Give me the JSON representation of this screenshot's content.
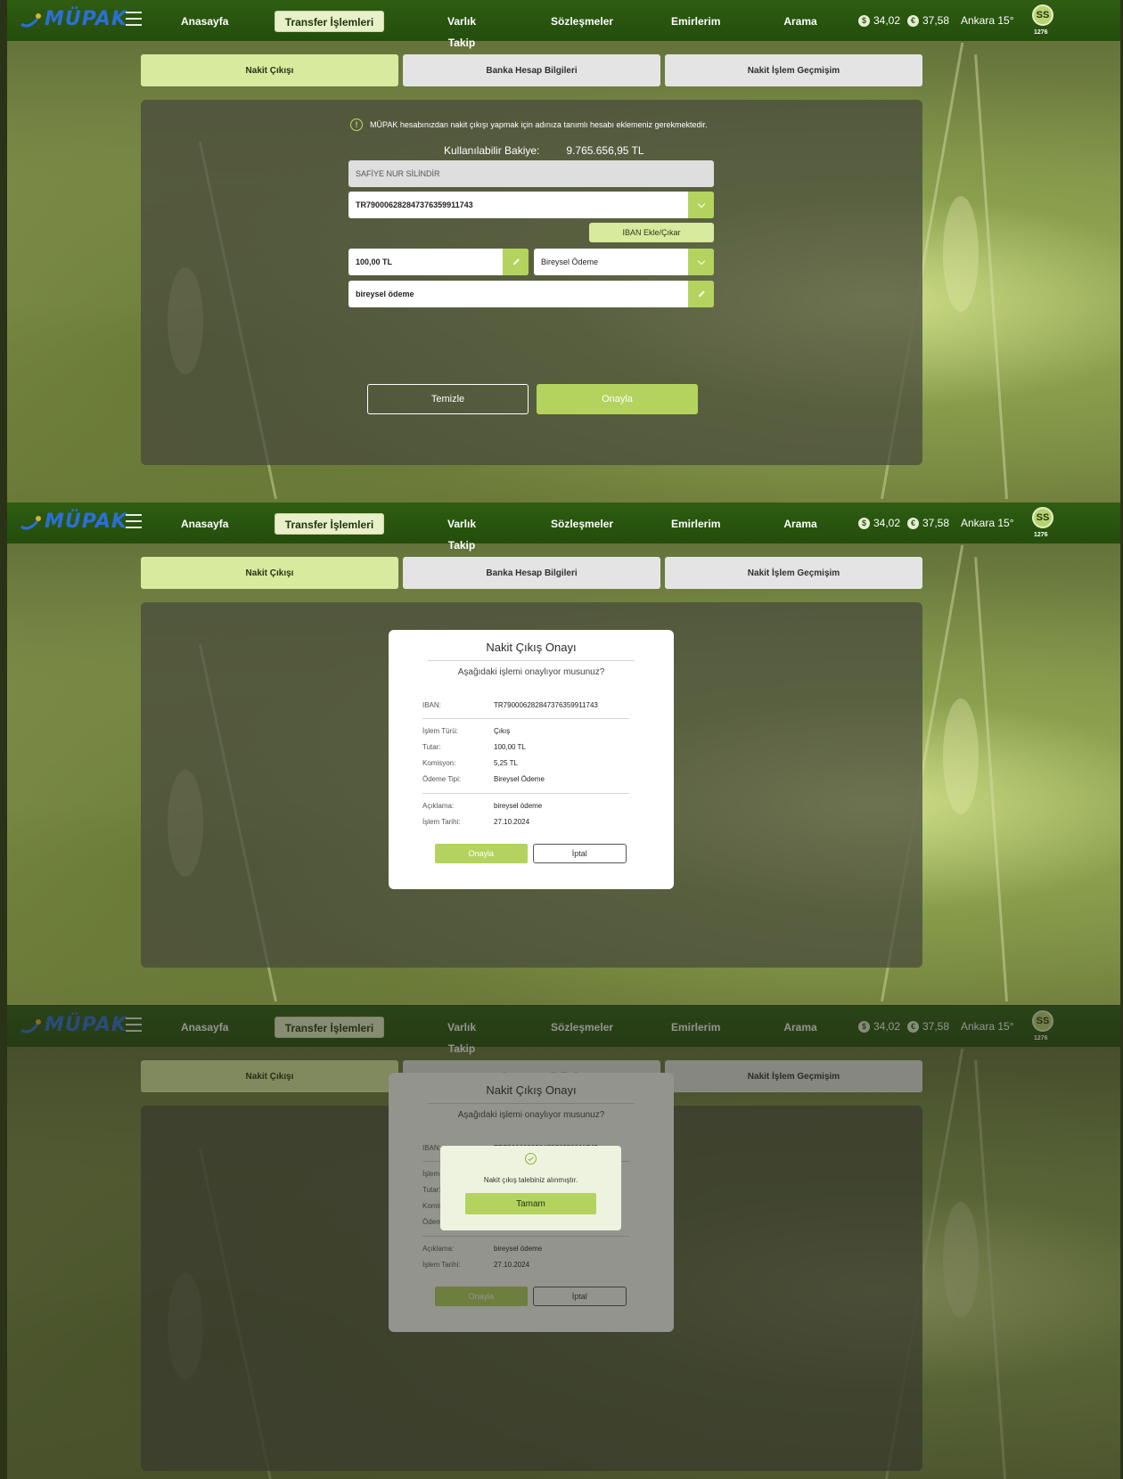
{
  "app": {
    "brand": "MÜPAK",
    "user_initials": "SS",
    "user_code": "1276"
  },
  "nav": {
    "items": [
      "Anasayfa",
      "Transfer İşlemleri",
      "Varlık Takip",
      "Sözleşmeler",
      "Emirlerim",
      "Arama"
    ],
    "active": "Transfer İşlemleri",
    "usd_symbol": "$",
    "usd_rate": "34,02",
    "eur_symbol": "€",
    "eur_rate": "37,58",
    "weather": "Ankara 15°"
  },
  "tabs": [
    "Nakit Çıkışı",
    "Banka Hesap Bilgileri",
    "Nakit İşlem Geçmişim"
  ],
  "form": {
    "info": "MÜPAK hesabınızdan nakit çıkışı yapmak için adınıza tanımlı hesabı eklemeniz gerekmektedir.",
    "balance_label": "Kullanılabilir Bakiye:",
    "balance_value": "9.765.656,95 TL",
    "name": "SAFİYE NUR SİLİNDİR",
    "iban": "TR790006282847376359911743",
    "iban_button": "IBAN Ekle/Çıkar",
    "amount": "100,00 TL",
    "payment_type": "Bireysel Ödeme",
    "description": "bireysel ödeme",
    "clear_button": "Temizle",
    "confirm_button": "Onayla"
  },
  "modal": {
    "title": "Nakit Çıkış Onayı",
    "subtitle": "Aşağıdaki işlemi onaylıyor musunuz?",
    "rows": {
      "iban": {
        "k": "IBAN:",
        "v": "TR790006282847376359911743"
      },
      "type": {
        "k": "İşlem Türü:",
        "v": "Çıkış"
      },
      "amount": {
        "k": "Tutar:",
        "v": "100,00 TL"
      },
      "commission": {
        "k": "Komisyon:",
        "v": "5,25 TL"
      },
      "payment": {
        "k": "Ödeme Tipi:",
        "v": "Bireysel Ödeme"
      },
      "desc": {
        "k": "Açıklama:",
        "v": "bireysel ödeme"
      },
      "date": {
        "k": "İşlem Tarihi:",
        "v": "27.10.2024"
      }
    },
    "ok_button": "Onayla",
    "cancel_button": "İptal"
  },
  "toast": {
    "message": "Nakit çıkış talebiniz alınmıştır.",
    "button": "Tamam"
  },
  "colors": {
    "nav_bg": "#2e5d12",
    "accent": "#b4d35e",
    "tab_active": "#d8ea9e"
  }
}
